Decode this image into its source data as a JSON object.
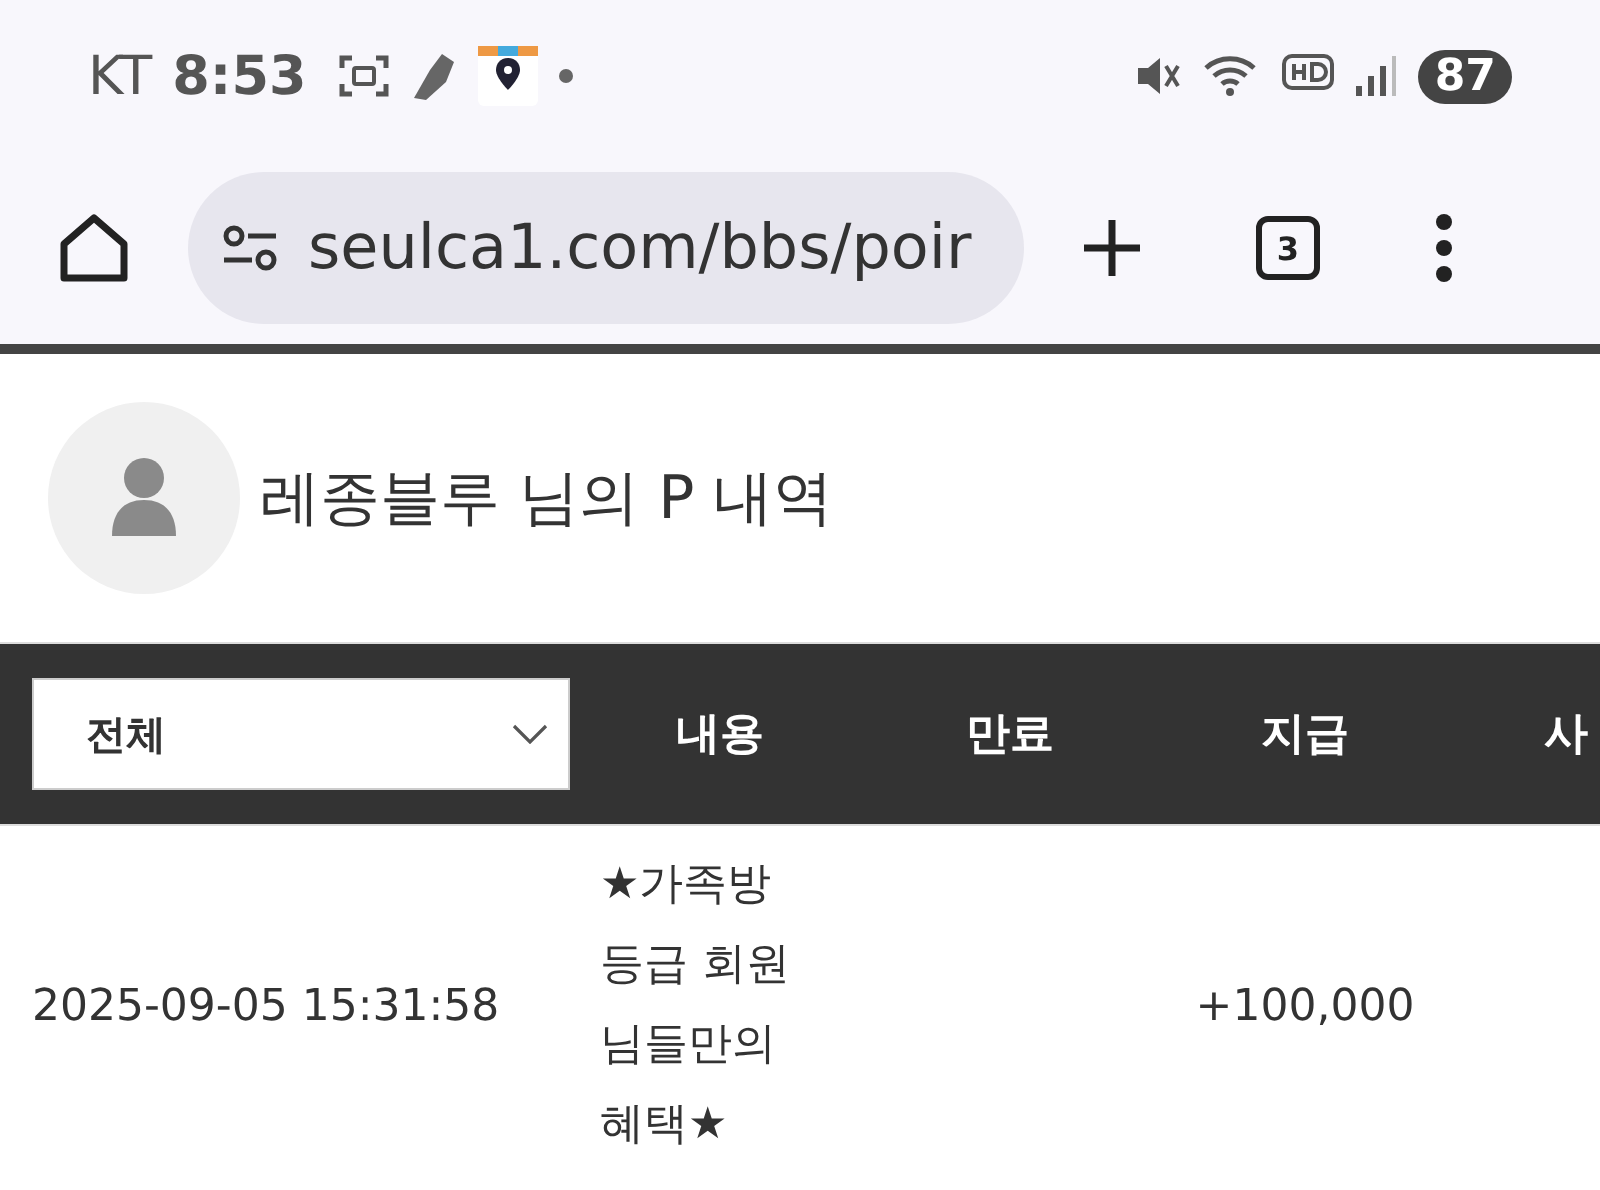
{
  "status_bar": {
    "carrier": "KT",
    "time": "8:53",
    "battery": "87"
  },
  "browser": {
    "url": "seulca1.com/bbs/poir",
    "tab_count": "3"
  },
  "profile": {
    "title": "레종블루 님의 P 내역"
  },
  "table": {
    "filter": {
      "value": "전체"
    },
    "columns": [
      "내용",
      "만료",
      "지급",
      "사"
    ],
    "rows": [
      {
        "date": "2025-09-05 15:31:58",
        "content": "★가족방 등급 회원 님들만의 혜택★",
        "expiry": "",
        "amount": "+100,000"
      }
    ]
  }
}
